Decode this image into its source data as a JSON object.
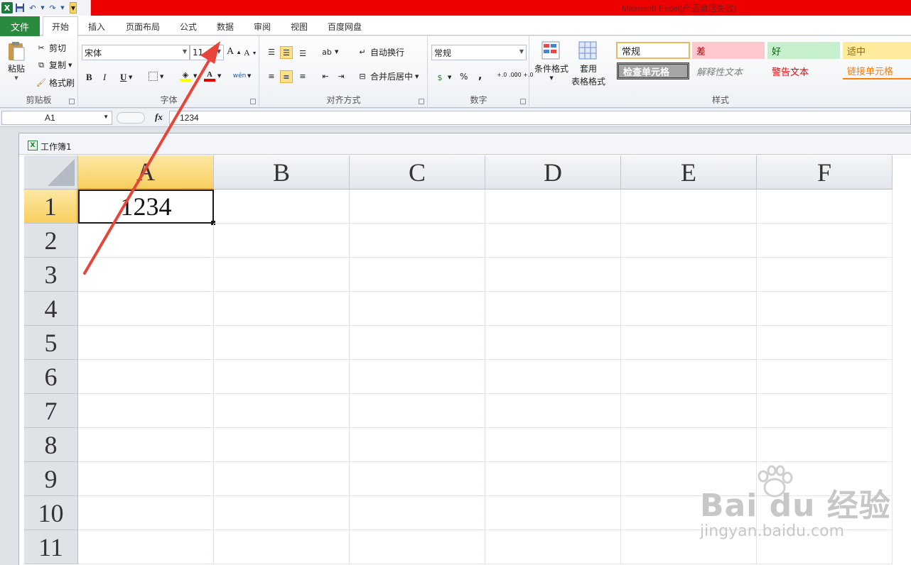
{
  "titlebar": {
    "title": "Microsoft Excel(产品激活失败)"
  },
  "tabs": {
    "file": "文件",
    "items": [
      "开始",
      "插入",
      "页面布局",
      "公式",
      "数据",
      "审阅",
      "视图",
      "百度网盘"
    ]
  },
  "ribbon": {
    "clipboard": {
      "label": "剪贴板",
      "paste": "粘贴",
      "cut": "剪切",
      "copy": "复制",
      "format_painter": "格式刷"
    },
    "font": {
      "label": "字体",
      "name": "宋体",
      "size": "11",
      "bold": "B",
      "italic": "I",
      "underline": "U",
      "grow": "A",
      "shrink": "A",
      "color_letter": "A",
      "wen": "wén"
    },
    "alignment": {
      "label": "对齐方式",
      "wrap": "自动换行",
      "merge": "合并后居中"
    },
    "number": {
      "label": "数字",
      "format": "常规",
      "percent": "%",
      "comma": ",",
      "inc_dec": "+.0 .00",
      "dec_dec": ".00 +.0"
    },
    "styles": {
      "label": "样式",
      "cond_format": "条件格式",
      "table_format_1": "套用",
      "table_format_2": "表格格式",
      "cells": [
        "常规",
        "差",
        "好",
        "适中",
        "检查单元格",
        "解释性文本",
        "警告文本",
        "链接单元格"
      ]
    }
  },
  "formula_bar": {
    "name_box": "A1",
    "fx": "fx",
    "value": "1234"
  },
  "workbook": {
    "title": "工作簿1"
  },
  "sheet": {
    "columns": [
      "A",
      "B",
      "C",
      "D",
      "E",
      "F"
    ],
    "rows": [
      "1",
      "2",
      "3",
      "4",
      "5",
      "6",
      "7",
      "8",
      "9",
      "10",
      "11"
    ],
    "cells": {
      "A1": "1234"
    },
    "selected_cell": "A1"
  },
  "watermark": {
    "brand": "Bai du 经验",
    "url": "jingyan.baidu.com"
  },
  "colors": {
    "titlebar": "#ee0000",
    "file_tab": "#2a8a3d",
    "header_active": "#f8cf5f",
    "arrow": "#e8443a"
  }
}
